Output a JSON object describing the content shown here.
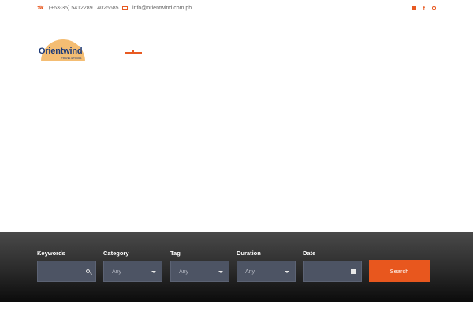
{
  "topbar": {
    "phone": "(+63-35) 5412289 | 4025685",
    "email": "info@orientwind.com.ph",
    "social_icons": [
      "envelope-icon",
      "facebook-icon",
      "instagram-icon"
    ]
  },
  "logo": {
    "brand": "Orientwind",
    "tagline": "TRAVEL & TOURS"
  },
  "search_form": {
    "keywords_label": "Keywords",
    "category_label": "Category",
    "category_value": "Any",
    "tag_label": "Tag",
    "tag_value": "Any",
    "duration_label": "Duration",
    "duration_value": "Any",
    "date_label": "Date",
    "submit_label": "Search"
  },
  "colors": {
    "accent": "#e8571e",
    "brand_blue": "#1d3a78",
    "field_bg": "#4d5464"
  }
}
